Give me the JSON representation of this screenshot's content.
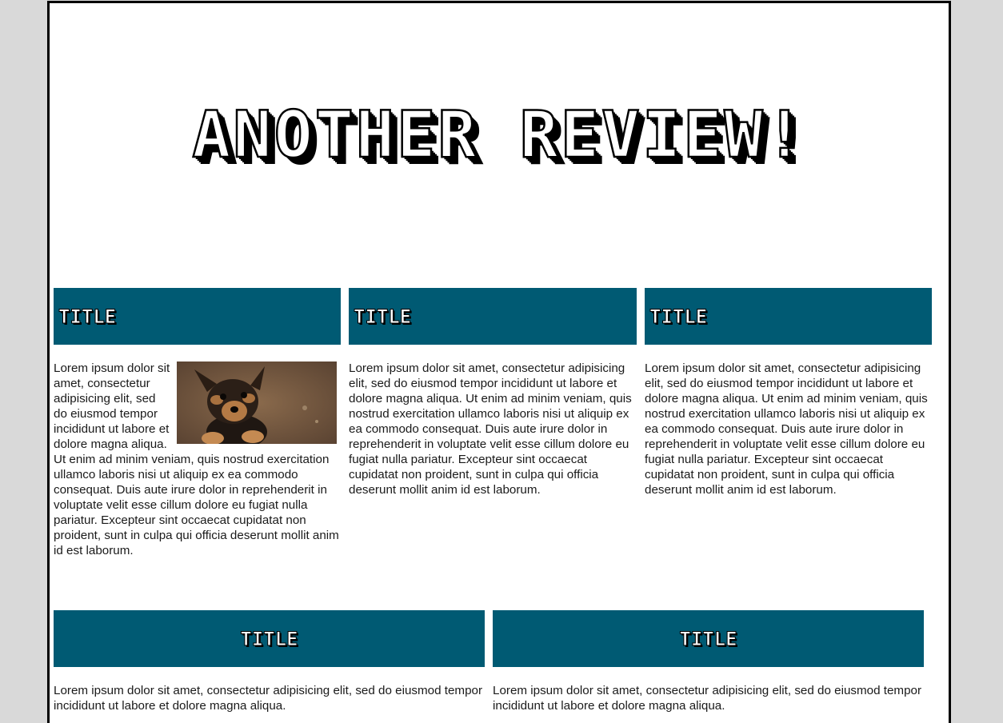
{
  "hero": {
    "title": "Another Review!"
  },
  "cards_top": [
    {
      "title": "Title",
      "text": "Lorem ipsum dolor sit amet, consectetur adipisicing elit, sed do eiusmod tempor incididunt ut labore et dolore magna aliqua. Ut enim ad minim veniam, quis nostrud exercitation ullamco laboris nisi ut aliquip ex ea commodo consequat. Duis aute irure dolor in reprehenderit in voluptate velit esse cillum dolore eu fugiat nulla pariatur. Excepteur sint occaecat cupidatat non proident, sunt in culpa qui officia deserunt mollit anim id est laborum.",
      "image": "puppy-photo"
    },
    {
      "title": "Title",
      "text": "Lorem ipsum dolor sit amet, consectetur adipisicing elit, sed do eiusmod tempor incididunt ut labore et dolore magna aliqua. Ut enim ad minim veniam, quis nostrud exercitation ullamco laboris nisi ut aliquip ex ea commodo consequat. Duis aute irure dolor in reprehenderit in voluptate velit esse cillum dolore eu fugiat nulla pariatur. Excepteur sint occaecat cupidatat non proident, sunt in culpa qui officia deserunt mollit anim id est laborum."
    },
    {
      "title": "Title",
      "text": "Lorem ipsum dolor sit amet, consectetur adipisicing elit, sed do eiusmod tempor incididunt ut labore et dolore magna aliqua. Ut enim ad minim veniam, quis nostrud exercitation ullamco laboris nisi ut aliquip ex ea commodo consequat. Duis aute irure dolor in reprehenderit in voluptate velit esse cillum dolore eu fugiat nulla pariatur. Excepteur sint occaecat cupidatat non proident, sunt in culpa qui officia deserunt mollit anim id est laborum."
    }
  ],
  "cards_bottom": [
    {
      "title": "Title",
      "text": "Lorem ipsum dolor sit amet, consectetur adipisicing elit, sed do eiusmod tempor incididunt ut labore et dolore magna aliqua."
    },
    {
      "title": "Title",
      "text": "Lorem ipsum dolor sit amet, consectetur adipisicing elit, sed do eiusmod tempor incididunt ut labore et dolore magna aliqua."
    }
  ],
  "colors": {
    "header_bg": "#005a73",
    "page_bg": "#ffffff",
    "outer_bg": "#d9d9d9",
    "border": "#000000"
  }
}
